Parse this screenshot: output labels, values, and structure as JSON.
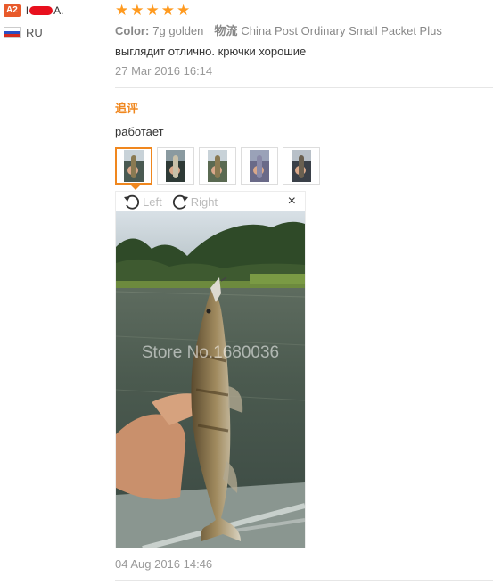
{
  "user": {
    "level": "A2",
    "name_first": "I",
    "name_last": "A.",
    "country": "RU"
  },
  "review": {
    "stars": 5,
    "color_label": "Color:",
    "color_value": "7g golden",
    "shipping_label": "物流",
    "shipping_value": "China Post Ordinary Small Packet Plus",
    "text": "выглядит отлично. крючки хорошие",
    "date": "27 Mar 2016 16:14"
  },
  "followup": {
    "label": "追评",
    "text": "работает",
    "thumbnail_count": 5,
    "viewer": {
      "rotate_left": "Left",
      "rotate_right": "Right",
      "close": "×",
      "watermark": "Store No.1680036"
    },
    "date": "04 Aug 2016 14:46"
  },
  "colors": {
    "accent": "#f0871e",
    "star": "#ff9a1f",
    "badge": "#e85a2b"
  }
}
